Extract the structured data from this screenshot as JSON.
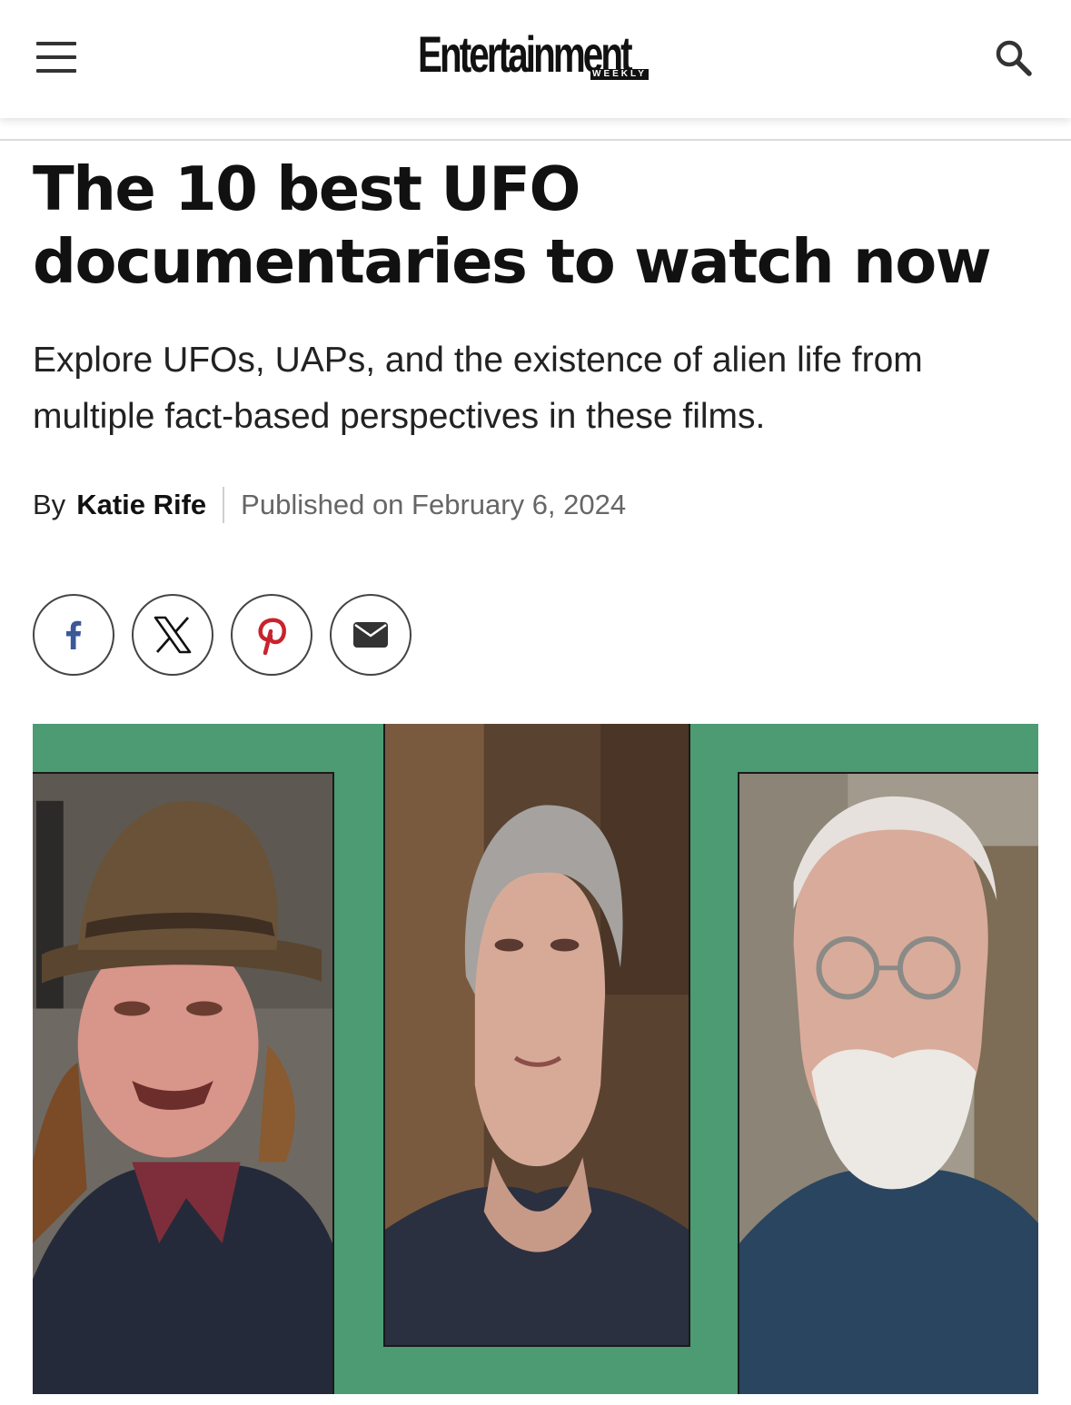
{
  "header": {
    "logo_text": "Entertainment",
    "logo_subtext": "WEEKLY"
  },
  "article": {
    "headline": "The 10 best UFO documentaries to watch now",
    "dek": "Explore UFOs, UAPs, and the existence of alien life from multiple fact-based perspectives in these films.",
    "byline_prefix": "By",
    "author": "Katie Rife",
    "published": "Published on February 6, 2024"
  },
  "share": {
    "buttons": [
      {
        "icon": "facebook-icon",
        "color": "#3b5998"
      },
      {
        "icon": "x-icon",
        "color": "#111111"
      },
      {
        "icon": "pinterest-icon",
        "color": "#c8232c"
      },
      {
        "icon": "email-icon",
        "color": "#333333"
      }
    ]
  },
  "hero": {
    "background_color": "#4c9b73",
    "panels": [
      {
        "subject": "man-in-brown-hat"
      },
      {
        "subject": "older-woman-gray-hair"
      },
      {
        "subject": "older-man-white-beard-glasses"
      }
    ]
  }
}
